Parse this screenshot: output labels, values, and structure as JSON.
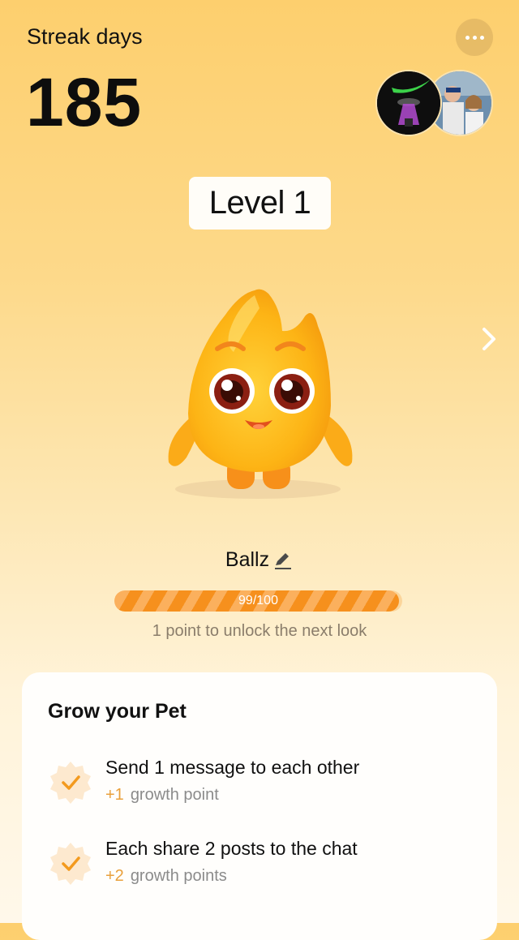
{
  "header": {
    "streak_label": "Streak days",
    "streak_count": "185",
    "more_icon": "more-horizontal-icon"
  },
  "level": {
    "label": "Level 1"
  },
  "pet": {
    "name": "Ballz",
    "edit_icon": "pencil-icon",
    "progress": {
      "label": "99/100",
      "value": 99,
      "max": 100
    },
    "unlock_note": "1 point to unlock the next look"
  },
  "grow_card": {
    "title": "Grow your Pet",
    "tasks": [
      {
        "title": "Send 1 message to each other",
        "points": "+1",
        "points_label": "growth point"
      },
      {
        "title": "Each share 2 posts to the chat",
        "points": "+2",
        "points_label": "growth points"
      }
    ]
  },
  "colors": {
    "accent": "#f6901d",
    "background_top": "#fdcf6e",
    "check": "#f39a1e"
  }
}
